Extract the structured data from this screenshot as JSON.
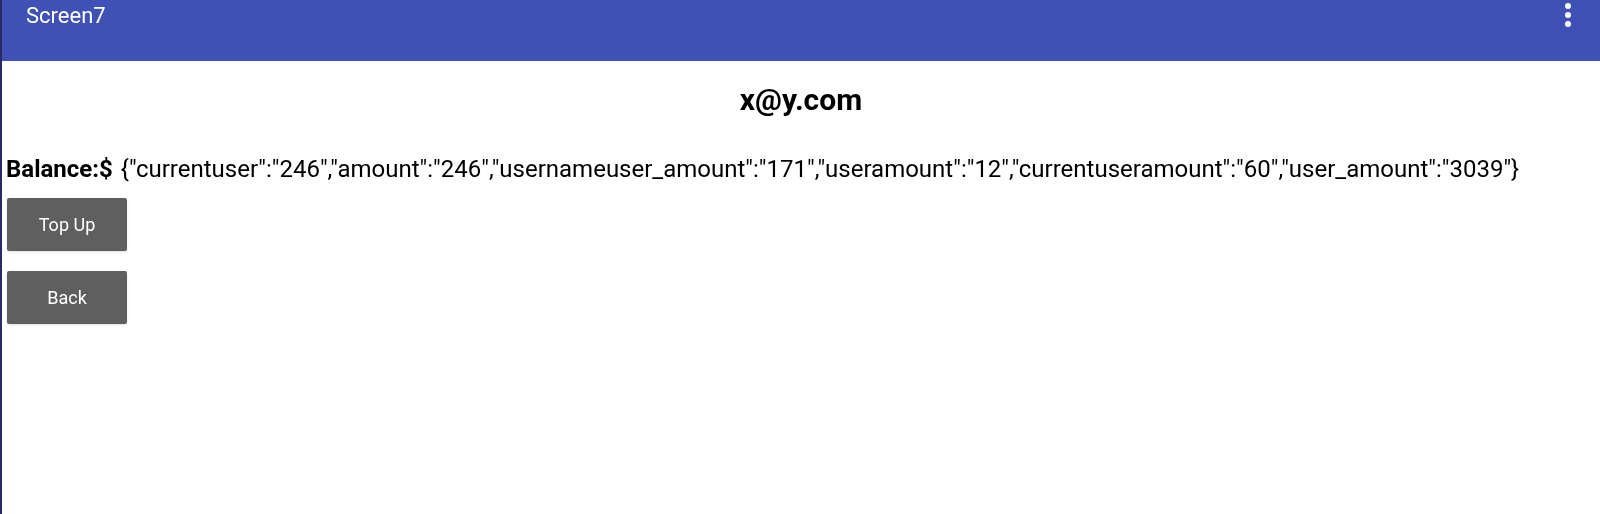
{
  "app_bar": {
    "title": "Screen7"
  },
  "email": "x@y.com",
  "balance": {
    "label": "Balance:$",
    "value": "{\"currentuser\":\"246\",\"amount\":\"246\",\"usernameuser_amount\":\"171\",\"useramount\":\"12\",\"currentuseramount\":\"60\",\"user_amount\":\"3039\"}"
  },
  "buttons": [
    "Top Up",
    "Back"
  ]
}
